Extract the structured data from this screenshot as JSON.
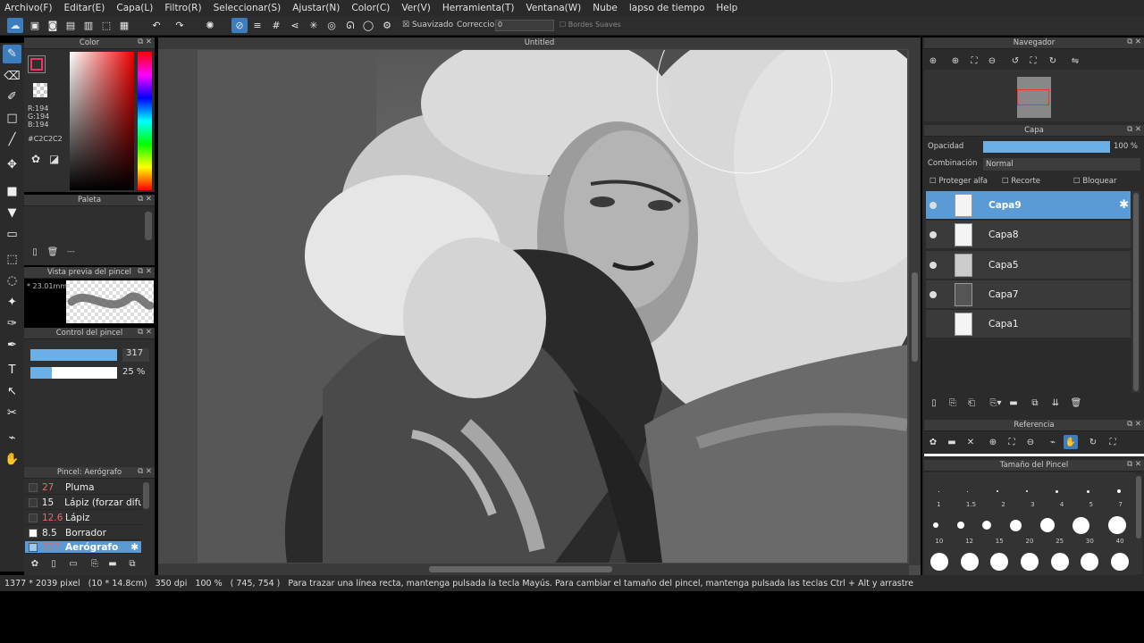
{
  "menu": [
    "Archivo(F)",
    "Editar(E)",
    "Capa(L)",
    "Filtro(R)",
    "Seleccionar(S)",
    "Ajustar(N)",
    "Color(C)",
    "Ver(V)",
    "Herramienta(T)",
    "Ventana(W)",
    "Nube",
    "lapso de tiempo",
    "Help"
  ],
  "toolbar": {
    "suavizado": "Suavizado",
    "correccion": "Correccion",
    "correccion_value": "0",
    "bordes": "Bordes Suaves"
  },
  "color_panel": {
    "title": "Color",
    "r": "R:194",
    "g": "G:194",
    "b": "B:194",
    "hex": "#C2C2C2",
    "current_color": "#C2C2C2"
  },
  "palette_panel": {
    "title": "Paleta",
    "dash": "---"
  },
  "brush_preview": {
    "title": "Vista previa del pincel",
    "size": "* 23.01mm"
  },
  "brush_control": {
    "title": "Control del pincel",
    "size_value": "317",
    "opacity_value": "25 %",
    "size_fraction": 1.0,
    "opacity_fraction": 0.25
  },
  "brush_list": {
    "title": "Pincel: Aerógrafo",
    "items": [
      {
        "size": "27",
        "name": "Pluma"
      },
      {
        "size": "15",
        "name": "Lápiz (forzar difun"
      },
      {
        "size": "12.6",
        "name": "Lápiz"
      },
      {
        "size": "8.5",
        "name": "Borrador"
      },
      {
        "size": "117",
        "name": "Aerógrafo"
      }
    ]
  },
  "canvas": {
    "title": "Untitled"
  },
  "status": {
    "dimensions": "1377 * 2039 pixel",
    "physical": "(10 * 14.8cm)",
    "dpi": "350 dpi",
    "zoom": "100 %",
    "coords": "( 745, 754 )",
    "hint": "Para trazar una línea recta, mantenga pulsada la tecla Mayús. Para cambiar el tamaño del pincel, mantenga pulsada las teclas Ctrl + Alt y arrastre"
  },
  "navigator": {
    "title": "Navegador"
  },
  "layer_panel": {
    "title": "Capa",
    "opacity_label": "Opacidad",
    "opacity_value": "100 %",
    "blend_label": "Combinación",
    "blend_value": "Normal",
    "protect_alpha": "Proteger alfa",
    "clipping": "Recorte",
    "lock": "Bloquear",
    "layers": [
      {
        "name": "Capa9"
      },
      {
        "name": "Capa8"
      },
      {
        "name": "Capa5"
      },
      {
        "name": "Capa7"
      },
      {
        "name": "Capa1"
      }
    ]
  },
  "reference": {
    "title": "Referencia"
  },
  "brush_size_panel": {
    "title": "Tamaño del Pincel",
    "row1": [
      "1",
      "1.5",
      "2",
      "3",
      "4",
      "5",
      "7"
    ],
    "row2": [
      "10",
      "12",
      "15",
      "20",
      "25",
      "30",
      "40"
    ]
  }
}
